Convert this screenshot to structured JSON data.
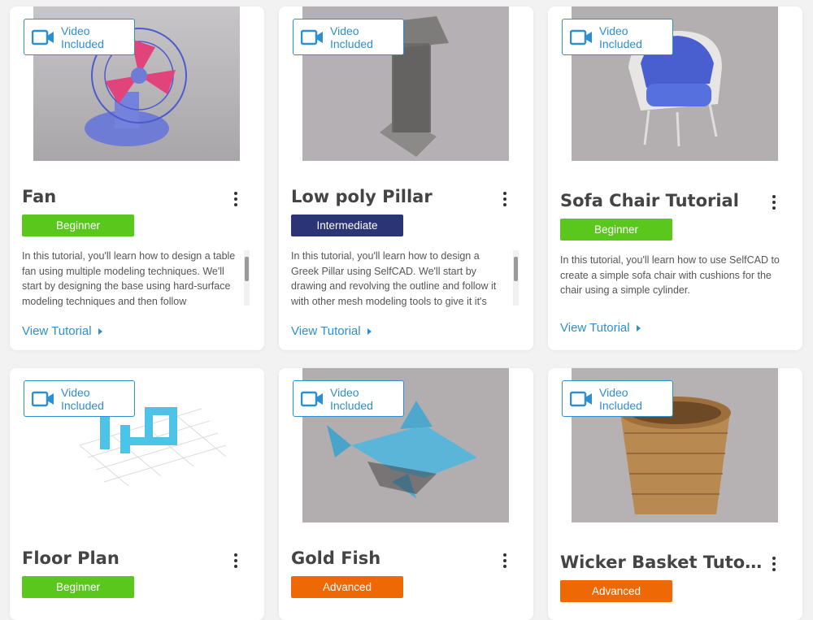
{
  "video_label": "Video Included",
  "view_label": "View Tutorial",
  "colors": {
    "beginner": "#5ac71c",
    "intermediate": "#2b3575",
    "advanced": "#ef6806",
    "link": "#2d8fd0"
  },
  "cards": [
    {
      "title": "Fan",
      "level": "Beginner",
      "desc": "In this tutorial, you'll learn how to design a table fan using multiple modeling techniques. We'll start by designing the base using hard-surface modeling techniques and then follow",
      "scroll": true
    },
    {
      "title": "Low poly Pillar",
      "level": "Intermediate",
      "desc": "In this tutorial, you'll learn how to design a Greek Pillar using SelfCAD. We'll start by drawing and revolving the outline and follow it with other mesh modeling tools to give it it's",
      "scroll": true
    },
    {
      "title": "Sofa Chair Tutorial",
      "level": "Beginner",
      "desc": "In this tutorial, you'll learn how to use SelfCAD to create a simple sofa chair with cushions for the chair using a simple cylinder.",
      "scroll": false
    },
    {
      "title": "Floor Plan",
      "level": "Beginner"
    },
    {
      "title": "Gold Fish",
      "level": "Advanced"
    },
    {
      "title": "Wicker Basket Tuto...",
      "level": "Advanced"
    }
  ]
}
